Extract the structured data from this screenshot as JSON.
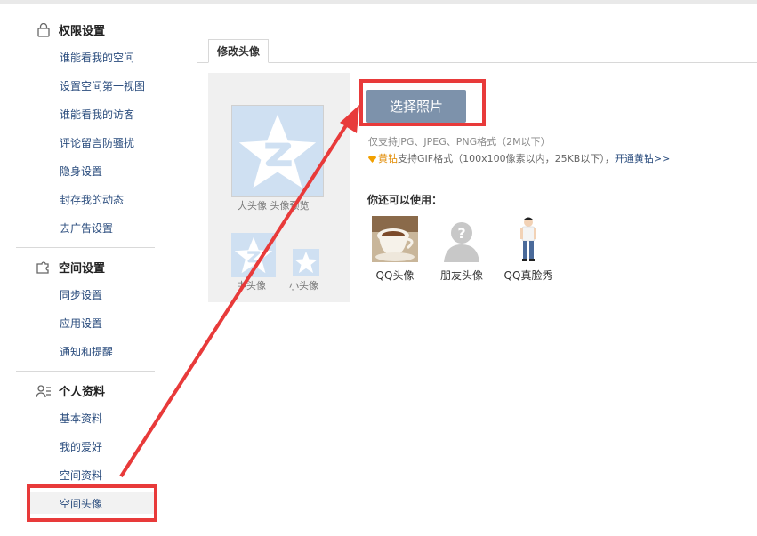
{
  "sidebar": {
    "sections": [
      {
        "title": "权限设置",
        "icon": "lock-icon",
        "items": [
          "谁能看我的空间",
          "设置空间第一视图",
          "谁能看我的访客",
          "评论留言防骚扰",
          "隐身设置",
          "封存我的动态",
          "去广告设置"
        ]
      },
      {
        "title": "空间设置",
        "icon": "puzzle-icon",
        "items": [
          "同步设置",
          "应用设置",
          "通知和提醒"
        ]
      },
      {
        "title": "个人资料",
        "icon": "user-list-icon",
        "items": [
          "基本资料",
          "我的爱好",
          "空间资料",
          "空间头像"
        ]
      }
    ],
    "active_item": "空间头像"
  },
  "main": {
    "tab_label": "修改头像",
    "preview": {
      "big_label": "大头像 头像预览",
      "mid_label": "中头像",
      "small_label": "小头像"
    },
    "choose_button": "选择照片",
    "hint_formats": "仅支持JPG、JPEG、PNG格式（2M以下）",
    "hint_vip": {
      "badge": "黄钻",
      "text": "支持GIF格式（100x100像素以内，25KB以下），",
      "link": "开通黄钻>>"
    },
    "also_title": "你还可以使用：",
    "options": [
      "QQ头像",
      "朋友头像",
      "QQ真脸秀"
    ]
  },
  "colors": {
    "annotation_red": "#e83a3a",
    "button_bg": "#7d92ab",
    "link_blue": "#2b4d7e",
    "avatar_blue": "#cfe0f2"
  }
}
